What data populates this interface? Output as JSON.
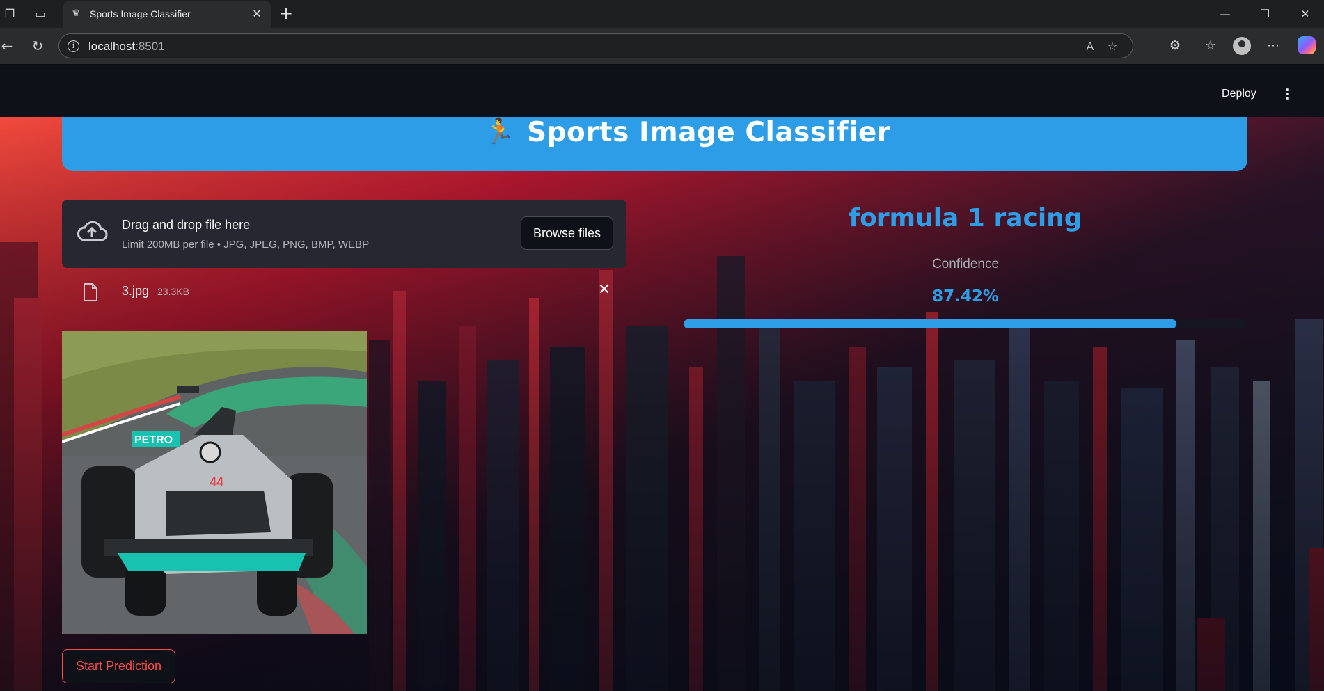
{
  "browser": {
    "tab_title": "Sports Image Classifier",
    "url_host": "localhost",
    "url_port": ":8501"
  },
  "app": {
    "deploy_label": "Deploy",
    "title_emoji": "🏃",
    "title": "Sports Image Classifier"
  },
  "uploader": {
    "drop_text": "Drag and drop file here",
    "limit_text": "Limit 200MB per file • JPG, JPEG, PNG, BMP, WEBP",
    "browse_label": "Browse files"
  },
  "file": {
    "name": "3.jpg",
    "size": "23.3KB",
    "preview_text": "PETRO",
    "car_number": "44"
  },
  "actions": {
    "predict_label": "Start Prediction"
  },
  "result": {
    "label": "formula 1 racing",
    "confidence_label": "Confidence",
    "confidence_value": "87.42%",
    "confidence_fraction": 0.8742
  },
  "colors": {
    "accent": "#2e9de8",
    "primary_red": "#ff4b4b",
    "uploader_bg": "#262730",
    "header_bg": "#0e1117"
  },
  "icons": {
    "tab_actions": "workspaces-icon",
    "vertical_tabs": "tabs-icon",
    "favicon": "crown-icon",
    "upload": "cloud-upload-icon",
    "file": "file-icon",
    "remove": "close-icon",
    "menu": "kebab-menu-icon"
  }
}
